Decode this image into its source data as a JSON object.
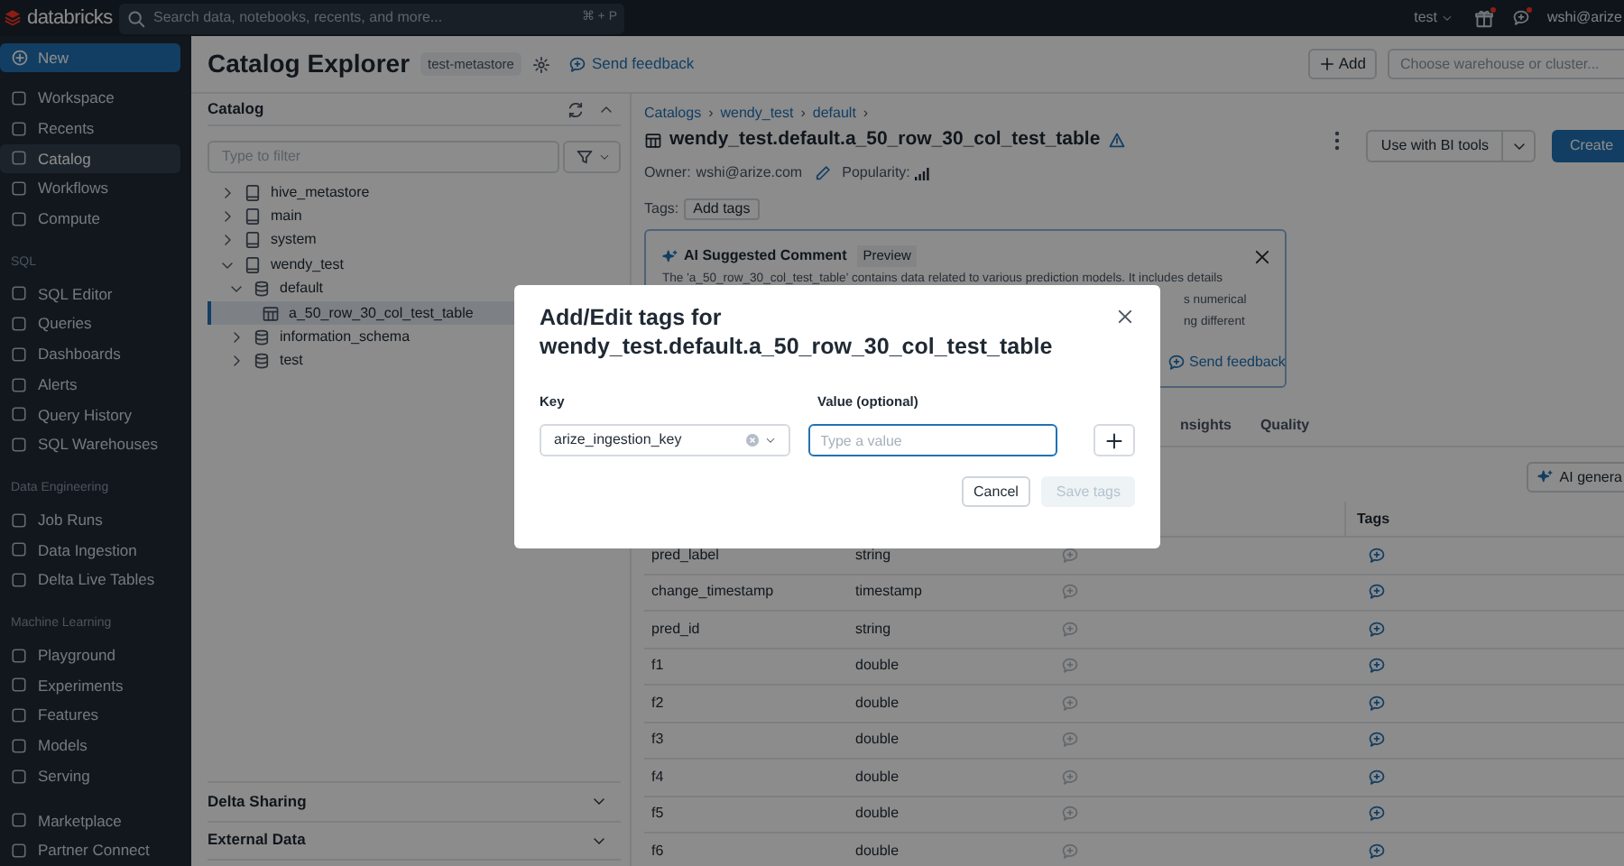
{
  "top_bar": {
    "logo": "databricks",
    "search": {
      "placeholder": "Search data, notebooks, recents, and more...",
      "shortcut": "⌘ + P"
    },
    "workspace": "test",
    "user": "wshi@arize"
  },
  "sidebar": {
    "new_button": "New",
    "sections": [
      {
        "items": [
          {
            "label": "Workspace",
            "selected": false
          },
          {
            "label": "Recents",
            "selected": false
          },
          {
            "label": "Catalog",
            "selected": true
          },
          {
            "label": "Workflows",
            "selected": false
          },
          {
            "label": "Compute",
            "selected": false
          }
        ]
      },
      {
        "title": "SQL",
        "items": [
          {
            "label": "SQL Editor",
            "selected": false
          },
          {
            "label": "Queries",
            "selected": false
          },
          {
            "label": "Dashboards",
            "selected": false
          },
          {
            "label": "Alerts",
            "selected": false
          },
          {
            "label": "Query History",
            "selected": false
          },
          {
            "label": "SQL Warehouses",
            "selected": false
          }
        ]
      },
      {
        "title": "Data Engineering",
        "items": [
          {
            "label": "Job Runs",
            "selected": false
          },
          {
            "label": "Data Ingestion",
            "selected": false
          },
          {
            "label": "Delta Live Tables",
            "selected": false
          }
        ]
      },
      {
        "title": "Machine Learning",
        "items": [
          {
            "label": "Playground",
            "selected": false
          },
          {
            "label": "Experiments",
            "selected": false
          },
          {
            "label": "Features",
            "selected": false
          },
          {
            "label": "Models",
            "selected": false
          },
          {
            "label": "Serving",
            "selected": false
          }
        ]
      },
      {
        "items": [
          {
            "label": "Marketplace",
            "selected": false
          },
          {
            "label": "Partner Connect",
            "selected": false
          }
        ]
      }
    ]
  },
  "header": {
    "title": "Catalog Explorer",
    "metastore": "test-metastore",
    "feedback": "Send feedback",
    "add_button": "Add",
    "compute": {
      "placeholder": "Choose warehouse or cluster..."
    }
  },
  "catalog_panel": {
    "title": "Catalog",
    "filter": {
      "placeholder": "Type to filter"
    },
    "tree": [
      {
        "label": "hive_metastore",
        "kind": "catalog",
        "expanded": false,
        "selected": false
      },
      {
        "label": "main",
        "kind": "catalog",
        "expanded": false,
        "selected": false
      },
      {
        "label": "system",
        "kind": "catalog",
        "expanded": false,
        "selected": false
      },
      {
        "label": "wendy_test",
        "kind": "catalog",
        "expanded": true,
        "selected": false,
        "children": [
          {
            "label": "default",
            "kind": "schema",
            "expanded": true,
            "selected": false,
            "children": [
              {
                "label": "a_50_row_30_col_test_table",
                "kind": "table",
                "selected": true
              }
            ]
          },
          {
            "label": "information_schema",
            "kind": "schema",
            "expanded": false,
            "selected": false
          },
          {
            "label": "test",
            "kind": "schema",
            "expanded": false,
            "selected": false
          }
        ]
      }
    ],
    "sections": [
      {
        "label": "Delta Sharing",
        "expanded": false
      },
      {
        "label": "External Data",
        "expanded": false
      }
    ]
  },
  "detail": {
    "breadcrumbs": [
      {
        "label": "Catalogs",
        "separator": "›"
      },
      {
        "label": "wendy_test",
        "separator": "›"
      },
      {
        "label": "default",
        "separator": "›"
      }
    ],
    "title": "wendy_test.default.a_50_row_30_col_test_table",
    "owner_label": "Owner:",
    "owner": "wshi@arize.com",
    "popularity_label": "Popularity:",
    "tags_label": "Tags:",
    "add_tags": "Add tags",
    "bi_button": "Use with BI tools",
    "create_button": "Create",
    "ai_comment": {
      "title": "AI Suggested Comment",
      "badge": "Preview",
      "line_1": "The 'a_50_row_30_col_test_table' contains data related to various prediction models. It includes details",
      "line_2": "s numerical",
      "line_3": "ng different",
      "feedback": "Send feedback"
    },
    "tabs": [
      {
        "label": "nsights",
        "selected": false
      },
      {
        "label": "Quality",
        "selected": false
      }
    ],
    "ai_generate": "AI genera",
    "table": {
      "columns": [
        "Tags"
      ],
      "rows": [
        {
          "name": "pred_label",
          "type": "string"
        },
        {
          "name": "change_timestamp",
          "type": "timestamp"
        },
        {
          "name": "pred_id",
          "type": "string"
        },
        {
          "name": "f1",
          "type": "double"
        },
        {
          "name": "f2",
          "type": "double"
        },
        {
          "name": "f3",
          "type": "double"
        },
        {
          "name": "f4",
          "type": "double"
        },
        {
          "name": "f5",
          "type": "double"
        },
        {
          "name": "f6",
          "type": "double"
        }
      ]
    }
  },
  "modal": {
    "title": "Add/Edit tags for wendy_test.default.a_50_row_30_col_test_table",
    "key_label": "Key",
    "key_value": "arize_ingestion_key",
    "value_label": "Value (optional)",
    "value_placeholder": "Type a value",
    "cancel": "Cancel",
    "save": {
      "label": "Save tags",
      "disabled": true
    }
  }
}
